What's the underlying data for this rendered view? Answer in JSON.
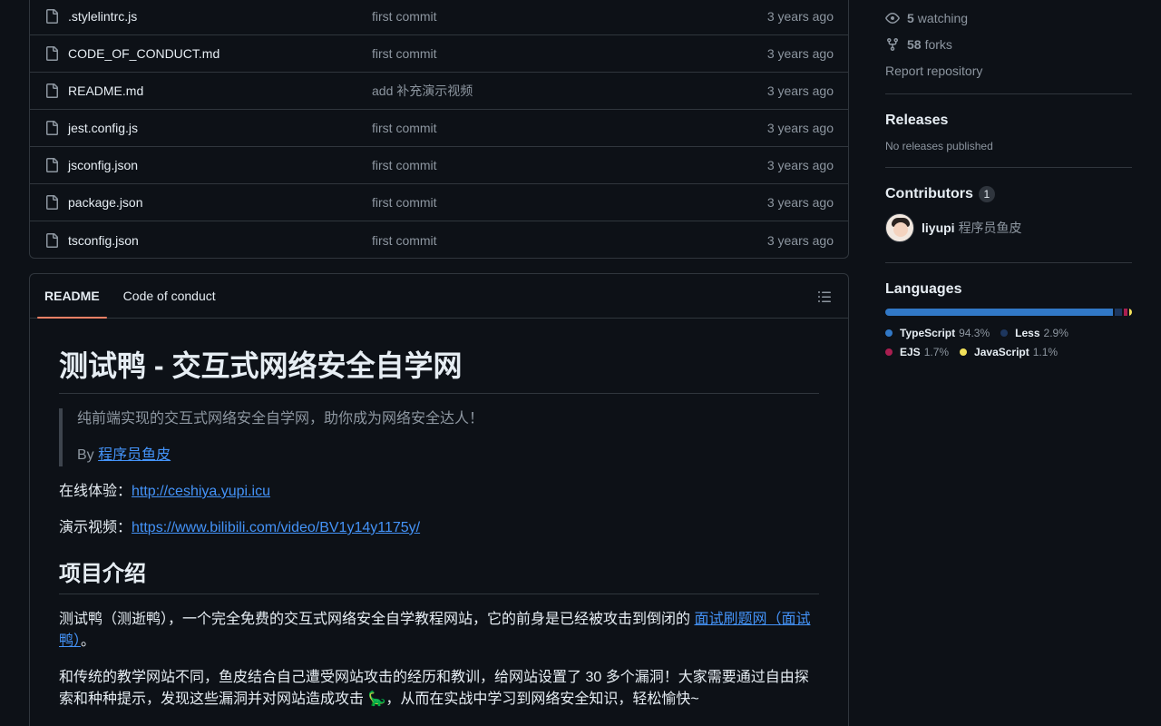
{
  "files": [
    {
      "name": ".stylelintrc.js",
      "message": "first commit",
      "age": "3 years ago"
    },
    {
      "name": "CODE_OF_CONDUCT.md",
      "message": "first commit",
      "age": "3 years ago"
    },
    {
      "name": "README.md",
      "message": "add 补充演示视频",
      "age": "3 years ago"
    },
    {
      "name": "jest.config.js",
      "message": "first commit",
      "age": "3 years ago"
    },
    {
      "name": "jsconfig.json",
      "message": "first commit",
      "age": "3 years ago"
    },
    {
      "name": "package.json",
      "message": "first commit",
      "age": "3 years ago"
    },
    {
      "name": "tsconfig.json",
      "message": "first commit",
      "age": "3 years ago"
    }
  ],
  "readme": {
    "tabs": [
      "README",
      "Code of conduct"
    ],
    "title": "测试鸭 - 交互式网络安全自学网",
    "quote_line1": "纯前端实现的交互式网络安全自学网，助你成为网络安全达人！",
    "quote_by": "By ",
    "quote_author": "程序员鱼皮",
    "online_label": "在线体验：",
    "online_link": "http://ceshiya.yupi.icu",
    "video_label": "演示视频：",
    "video_link": "https://www.bilibili.com/video/BV1y14y1175y/",
    "intro_heading": "项目介绍",
    "intro_p1_text": "测试鸭（测逝鸭），一个完全免费的交互式网络安全自学教程网站，它的前身是已经被攻击到倒闭的 ",
    "intro_p1_link": "面试刷题网（面试鸭）",
    "intro_p1_end": "。",
    "intro_p2": "和传统的教学网站不同，鱼皮结合自己遭受网站攻击的经历和教训，给网站设置了 30 多个漏洞！大家需要通过自由探索和种种提示，发现这些漏洞并对网站造成攻击 🦕，从而在实战中学习到网络安全知识，轻松愉快~"
  },
  "sidebar": {
    "watching_count": "5",
    "watching_label": "watching",
    "forks_count": "58",
    "forks_label": "forks",
    "report": "Report repository",
    "releases_title": "Releases",
    "releases_empty": "No releases published",
    "contributors_title": "Contributors",
    "contributors_count": "1",
    "contributor_login": "liyupi",
    "contributor_name": "程序员鱼皮",
    "languages_title": "Languages",
    "languages": [
      {
        "name": "TypeScript",
        "percent": "94.3%",
        "value": 94.3,
        "color": "#3178c6"
      },
      {
        "name": "Less",
        "percent": "2.9%",
        "value": 2.9,
        "color": "#1d365d"
      },
      {
        "name": "EJS",
        "percent": "1.7%",
        "value": 1.7,
        "color": "#a91e50"
      },
      {
        "name": "JavaScript",
        "percent": "1.1%",
        "value": 1.1,
        "color": "#f1e05a"
      }
    ]
  }
}
